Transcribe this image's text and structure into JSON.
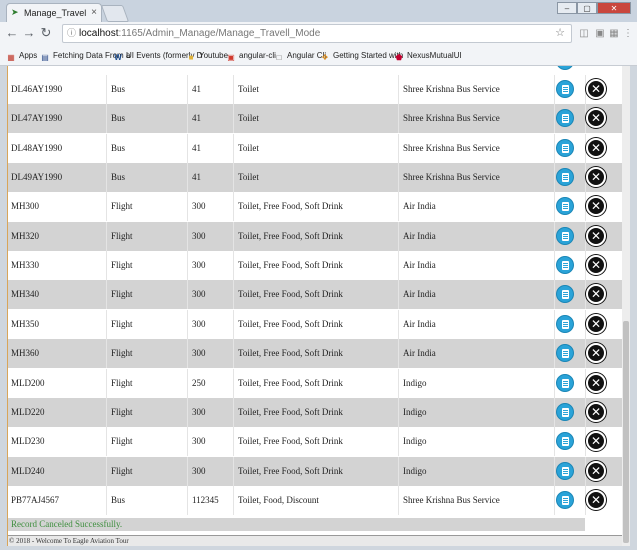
{
  "browser": {
    "tab_title": "Manage_Travell_Mode - ",
    "tab_close": "×",
    "url_host": "localhost",
    "url_path": ":1165/Admin_Manage/Manage_Travell_Mode",
    "window_buttons": [
      "–",
      "▢",
      "✕"
    ],
    "bookmarks": [
      {
        "label": "Apps",
        "icon": "apps-grid-icon"
      },
      {
        "label": "Fetching Data From a",
        "icon": "page-icon"
      },
      {
        "label": "UI Events (formerly D",
        "icon": "w3c-icon"
      },
      {
        "label": "Youtube",
        "icon": "folder-icon"
      },
      {
        "label": "angular-cli",
        "icon": "red-page-icon"
      },
      {
        "label": "Angular Cli",
        "icon": "page-icon"
      },
      {
        "label": "Getting Started with",
        "icon": "getting-started-icon"
      },
      {
        "label": "NexusMutualUI",
        "icon": "angular-shield-icon"
      }
    ]
  },
  "table": {
    "rows": [
      {
        "code": "DL46AY1990",
        "mode": "Bus",
        "count": "41",
        "facilities": "Toilet",
        "operator": "Shree Krishna Bus Service"
      },
      {
        "code": "DL47AY1990",
        "mode": "Bus",
        "count": "41",
        "facilities": "Toilet",
        "operator": "Shree Krishna Bus Service"
      },
      {
        "code": "DL48AY1990",
        "mode": "Bus",
        "count": "41",
        "facilities": "Toilet",
        "operator": "Shree Krishna Bus Service"
      },
      {
        "code": "DL49AY1990",
        "mode": "Bus",
        "count": "41",
        "facilities": "Toilet",
        "operator": "Shree Krishna Bus Service"
      },
      {
        "code": "MH300",
        "mode": "Flight",
        "count": "300",
        "facilities": "Toilet, Free Food, Soft Drink",
        "operator": "Air India"
      },
      {
        "code": "MH320",
        "mode": "Flight",
        "count": "300",
        "facilities": "Toilet, Free Food, Soft Drink",
        "operator": "Air India"
      },
      {
        "code": "MH330",
        "mode": "Flight",
        "count": "300",
        "facilities": "Toilet, Free Food, Soft Drink",
        "operator": "Air India"
      },
      {
        "code": "MH340",
        "mode": "Flight",
        "count": "300",
        "facilities": "Toilet, Free Food, Soft Drink",
        "operator": "Air India"
      },
      {
        "code": "MH350",
        "mode": "Flight",
        "count": "300",
        "facilities": "Toilet, Free Food, Soft Drink",
        "operator": "Air India"
      },
      {
        "code": "MH360",
        "mode": "Flight",
        "count": "300",
        "facilities": "Toilet, Free Food, Soft Drink",
        "operator": "Air India"
      },
      {
        "code": "MLD200",
        "mode": "Flight",
        "count": "250",
        "facilities": "Toilet, Free Food, Soft Drink",
        "operator": "Indigo"
      },
      {
        "code": "MLD220",
        "mode": "Flight",
        "count": "300",
        "facilities": "Toilet, Free Food, Soft Drink",
        "operator": "Indigo"
      },
      {
        "code": "MLD230",
        "mode": "Flight",
        "count": "300",
        "facilities": "Toilet, Free Food, Soft Drink",
        "operator": "Indigo"
      },
      {
        "code": "MLD240",
        "mode": "Flight",
        "count": "300",
        "facilities": "Toilet, Free Food, Soft Drink",
        "operator": "Indigo"
      },
      {
        "code": "PB77AJ4567",
        "mode": "Bus",
        "count": "112345",
        "facilities": "Toilet, Food, Discount",
        "operator": "Shree Krishna Bus Service"
      }
    ],
    "delete_glyph": "✕"
  },
  "message": "Record Canceled Successfully.",
  "footer": "© 2018 - Welcome To Eagle Aviation Tour",
  "colors": {
    "alt_row": "#d3d3d3",
    "edit_button": "#2aa3d8",
    "delete_button": "#111111",
    "success_text": "#3f8f3f"
  }
}
